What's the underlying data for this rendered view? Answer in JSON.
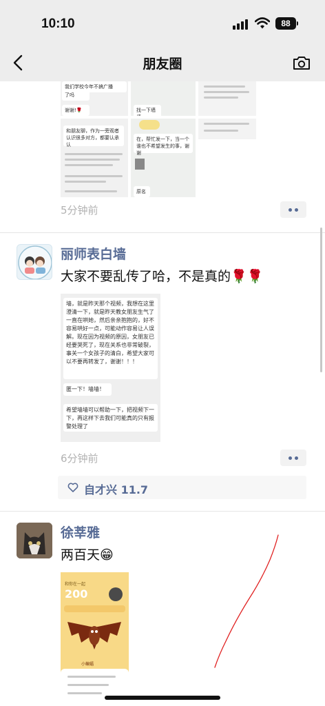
{
  "status_bar": {
    "time": "10:10",
    "battery": "88"
  },
  "nav": {
    "title": "朋友圈"
  },
  "post1": {
    "image_texts": {
      "a": "我们学校今年不搞广播",
      "b": "了吗",
      "c": "谢谢!🌹",
      "d": "和朋友聊，作为一旁观者认识很多对方，都要认承认",
      "e": "找一下墙墙",
      "f": "在，帮忙发一下，当一个谁也不希望发生的事，谢谢",
      "g": "帮忙发一下",
      "h": "原名"
    },
    "time_ago": "5分钟前"
  },
  "post2": {
    "name": "丽师表白墙",
    "text": "大家不要乱传了哈，不是真的🌹🌹",
    "image_texts": {
      "a": "墙，就是昨天那个视频，我想在这里澄清一下，就是昨天教女朋友生气了一直在哄她，然后亲亲抱抱的，好不容易哄好一点，可能动作容易让人误解。现在因为视频的原因，女朋友已经要哭死了，现在关系也非常破裂，事关一个女孩子的清白，希望大家可以不要再转发了，谢谢！！！",
      "b": "匿一下！墙墙！",
      "c": "希望墙墙可以帮助一下，把视频下一下，再这样下去我们可能真的只有报警处理了"
    },
    "time_ago": "6分钟前",
    "likes": "自才兴 11.7"
  },
  "post3": {
    "name": "徐莘雅",
    "text": "两百天😁",
    "image_texts": {
      "a": "和你在一起",
      "b": "200",
      "c": "小蝙蝠"
    }
  },
  "colors": {
    "link": "#576b95",
    "nav_bg": "#ededed",
    "meta": "#b2b2b2"
  }
}
